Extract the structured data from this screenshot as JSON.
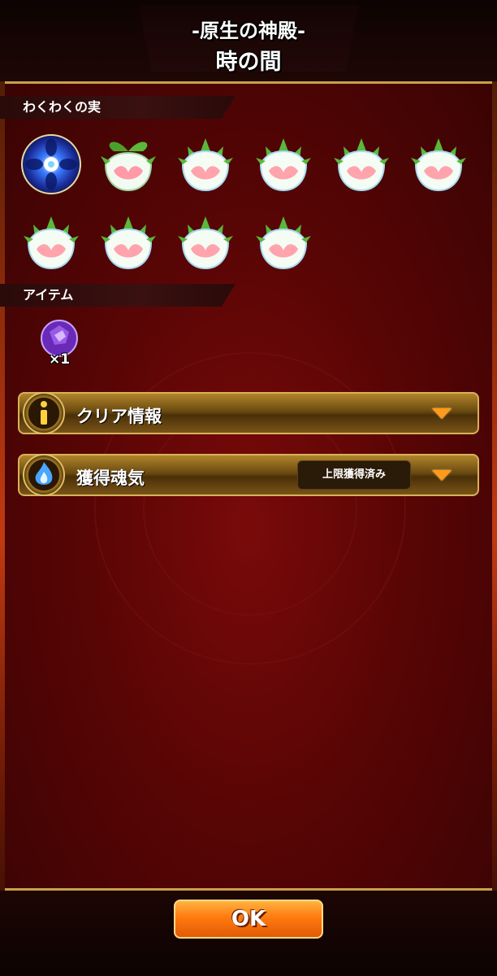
{
  "header": {
    "title_line1": "-原生の神殿-",
    "title_line2": "時の間"
  },
  "fruits_section": {
    "label": "わくわくの実",
    "items": [
      {
        "icon": "blue-orb-fruit-icon"
      },
      {
        "icon": "leaf-fruit-icon"
      },
      {
        "icon": "lotus-fruit-icon"
      },
      {
        "icon": "lotus-fruit-icon"
      },
      {
        "icon": "lotus-fruit-icon"
      },
      {
        "icon": "lotus-fruit-icon"
      },
      {
        "icon": "lotus-fruit-icon"
      },
      {
        "icon": "lotus-fruit-icon"
      },
      {
        "icon": "lotus-fruit-icon"
      },
      {
        "icon": "lotus-fruit-icon"
      }
    ]
  },
  "items_section": {
    "label": "アイテム",
    "item": {
      "icon": "purple-gem-icon",
      "count": "×1"
    }
  },
  "clear_info": {
    "label": "クリア情報",
    "icon": "info-icon"
  },
  "soul_gain": {
    "label": "獲得魂気",
    "badge": "上限獲得済み",
    "icon": "blue-flame-icon"
  },
  "footer": {
    "ok_label": "OK"
  },
  "colors": {
    "panel_red": "#5a0505",
    "gold_border": "#c9a04a",
    "ok_orange": "#ff7a10",
    "chevron_orange": "#ff9a1a"
  }
}
